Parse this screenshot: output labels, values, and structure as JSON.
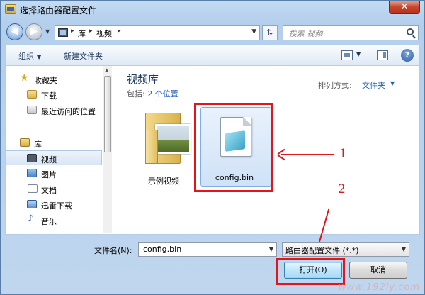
{
  "window": {
    "title": "选择路由器配置文件",
    "close_label": "✕"
  },
  "address": {
    "crumbs": [
      "库",
      "视频"
    ],
    "search_placeholder": "搜索 视频"
  },
  "toolbar": {
    "organize_label": "组织",
    "new_folder_label": "新建文件夹"
  },
  "sidebar": {
    "items": [
      {
        "label": "收藏夹",
        "icon": "star-icon"
      },
      {
        "label": "下载",
        "icon": "folder-icon"
      },
      {
        "label": "最近访问的位置",
        "icon": "recent-places-icon"
      },
      {
        "label": "库",
        "icon": "library-icon"
      },
      {
        "label": "视频",
        "icon": "video-icon"
      },
      {
        "label": "图片",
        "icon": "picture-icon"
      },
      {
        "label": "文档",
        "icon": "document-icon"
      },
      {
        "label": "迅雷下载",
        "icon": "thunder-icon"
      },
      {
        "label": "音乐",
        "icon": "music-icon"
      }
    ]
  },
  "content": {
    "library_title": "视频库",
    "includes_prefix": "包括: ",
    "includes_link": "2 个位置",
    "arrange_label": "排列方式:",
    "arrange_value": "文件夹",
    "files": [
      {
        "name": "示例视频",
        "type": "folder"
      },
      {
        "name": "config.bin",
        "type": "file"
      }
    ]
  },
  "annotations": {
    "label_1": "1",
    "label_2": "2",
    "color": "#e3141c"
  },
  "bottom": {
    "filename_label": "文件名(N):",
    "filename_value": "config.bin",
    "filter_value": "路由器配置文件 (*.*)",
    "open_label": "打开(O)",
    "cancel_label": "取消"
  },
  "watermark": "www.192ly.com"
}
